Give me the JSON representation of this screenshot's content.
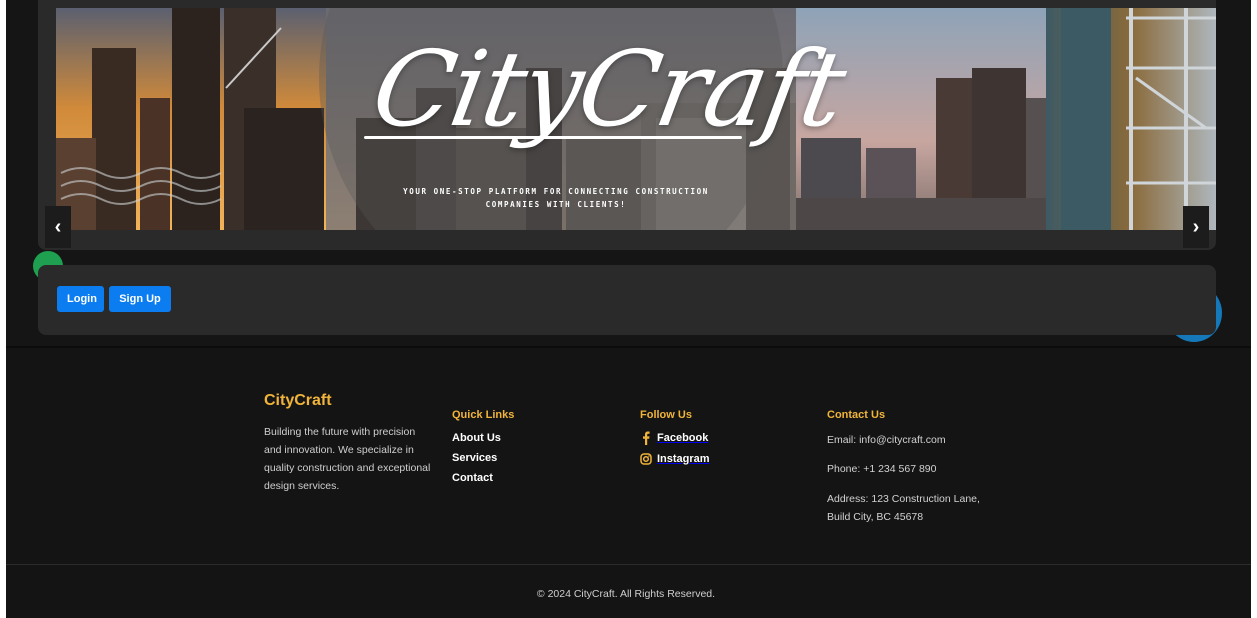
{
  "banner": {
    "logo": "CityCraft",
    "tagline": "Your one-stop platform for connecting construction companies with clients!"
  },
  "carousel": {
    "prev_label": "‹",
    "next_label": "›"
  },
  "auth": {
    "login_label": "Login",
    "signup_label": "Sign Up"
  },
  "footer": {
    "brand": {
      "title": "CityCraft",
      "description": "Building the future with precision and innovation. We specialize in quality construction and exceptional design services."
    },
    "quick_links": {
      "title": "Quick Links",
      "items": [
        "About Us",
        "Services",
        "Contact"
      ]
    },
    "follow_us": {
      "title": "Follow Us",
      "items": [
        {
          "label": "Facebook",
          "icon": "facebook-icon"
        },
        {
          "label": "Instagram",
          "icon": "instagram-icon"
        }
      ]
    },
    "contact": {
      "title": "Contact Us",
      "email": "Email: info@citycraft.com",
      "phone": "Phone: +1 234 567 890",
      "address": "Address: 123 Construction Lane, Build City, BC 45678"
    },
    "copyright": "© 2024 CityCraft. All Rights Reserved."
  },
  "colors": {
    "accent": "#f0b43a",
    "button": "#0b7df0",
    "background": "#141414",
    "card": "#2a2a2a"
  }
}
